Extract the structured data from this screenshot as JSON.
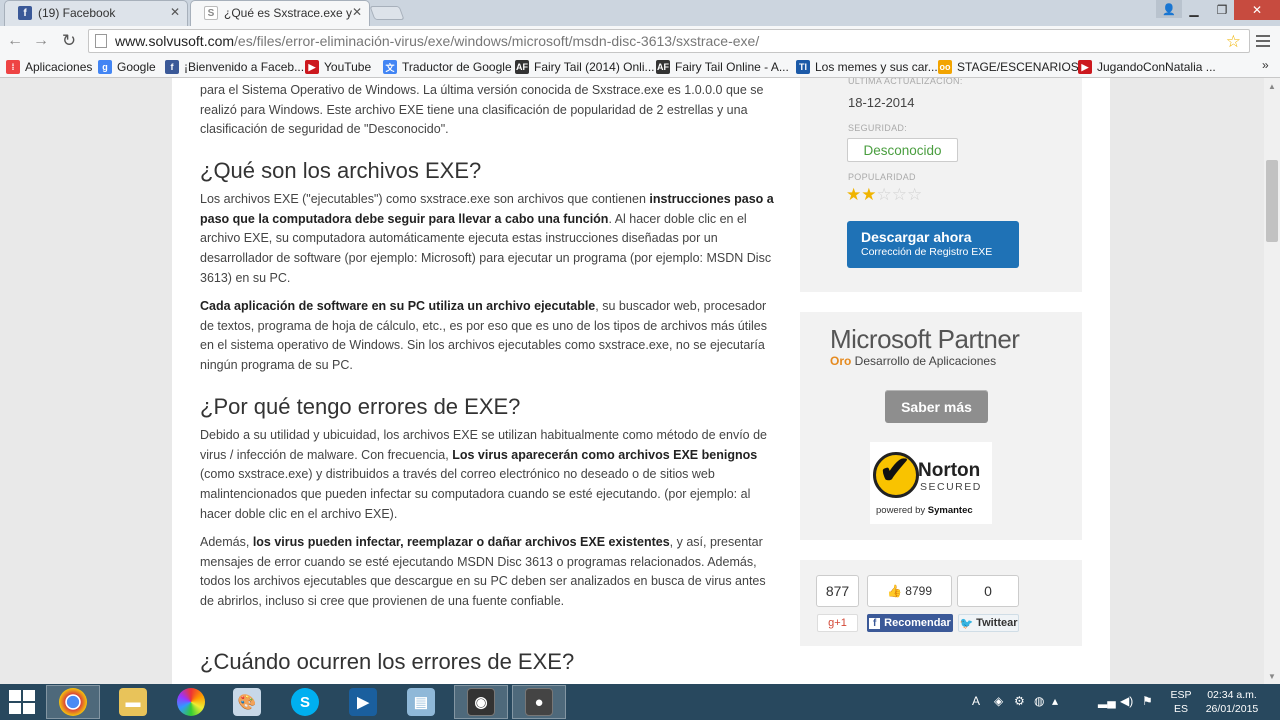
{
  "tabs": [
    {
      "title": "(19) Facebook",
      "favicon": "facebook-icon"
    },
    {
      "title": "¿Qué es Sxstrace.exe y cón",
      "favicon": "solvusoft-icon"
    }
  ],
  "address_bar": {
    "host": "www.solvusoft.com",
    "path": "/es/files/error-eliminación-virus/exe/windows/microsoft/msdn-disc-3613/sxstrace-exe/"
  },
  "bookmarks": [
    {
      "label": "Aplicaciones",
      "icon": "apps-grid-icon",
      "color": "#e44"
    },
    {
      "label": "Google",
      "icon": "google-icon",
      "color": "#4285f4"
    },
    {
      "label": "¡Bienvenido a Faceb...",
      "icon": "facebook-icon",
      "color": "#3b5998"
    },
    {
      "label": "YouTube",
      "icon": "youtube-icon",
      "color": "#cc181e"
    },
    {
      "label": "Traductor de Google",
      "icon": "translate-icon",
      "color": "#4285f4"
    },
    {
      "label": "Fairy Tail (2014) Onli...",
      "icon": "af-icon",
      "color": "#333"
    },
    {
      "label": "Fairy Tail Online - A...",
      "icon": "af-icon",
      "color": "#333"
    },
    {
      "label": "Los memes y sus car...",
      "icon": "ti-icon",
      "color": "#1c5aa8"
    },
    {
      "label": "STAGE/ESCENARIOS...",
      "icon": "stage-icon",
      "color": "#f2a400"
    },
    {
      "label": "JugandoConNatalia ...",
      "icon": "youtube-icon",
      "color": "#cc181e"
    }
  ],
  "article": {
    "intro": "para el Sistema Operativo de Windows. La última versión conocida de Sxstrace.exe es 1.0.0.0 que se realizó para Windows. Este archivo EXE tiene una clasificación de popularidad de 2 estrellas y una clasificación de seguridad de \"Desconocido\".",
    "h1": "¿Qué son los archivos EXE?",
    "p1a": "Los archivos EXE (\"ejecutables\") como sxstrace.exe son archivos que contienen ",
    "p1b": "instrucciones paso a paso que la computadora debe seguir para llevar a cabo una función",
    "p1c": ". Al hacer doble clic en el archivo EXE, su computadora automáticamente ejecuta estas instrucciones diseñadas por un desarrollador de software (por ejemplo: Microsoft) para ejecutar un programa (por ejemplo: MSDN Disc 3613) en su PC.",
    "p2a": "Cada aplicación de software en su PC utiliza un archivo ejecutable",
    "p2b": ", su buscador web, procesador de textos, programa de hoja de cálculo, etc., es por eso que es uno de los tipos de archivos más útiles en el sistema operativo de Windows. Sin los archivos ejecutables como sxstrace.exe, no se ejecutaría ningún programa de su PC.",
    "h2": "¿Por qué tengo errores de EXE?",
    "p3a": "Debido a su utilidad y ubicuidad, los archivos EXE se utilizan habitualmente como método de envío de virus / infección de malware. Con frecuencia, ",
    "p3b": "Los virus aparecerán como archivos EXE benignos",
    "p3c": " (como sxstrace.exe) y distribuidos a través del correo electrónico no deseado o de sitios web malintencionados que pueden infectar su computadora cuando se esté ejecutando. (por ejemplo: al hacer doble clic en el archivo EXE).",
    "p4a": "Además, ",
    "p4b": "los virus pueden infectar, reemplazar o dañar archivos EXE existentes",
    "p4c": ", y así, presentar mensajes de error cuando se esté ejecutando MSDN Disc 3613 o programas relacionados. Además, todos los archivos ejecutables que descargue en su PC deben ser analizados en busca de virus antes de abrirlos, incluso si cree que provienen de una fuente confiable.",
    "h3": "¿Cuándo ocurren los errores de EXE?"
  },
  "sidebar": {
    "last_update_label": "ÚLTIMA ACTUALIZACIÓN:",
    "last_update_value": "18-12-2014",
    "security_label": "SEGURIDAD:",
    "security_value": "Desconocido",
    "popularity_label": "POPULARIDAD",
    "popularity_stars": 2,
    "popularity_max": 5,
    "download_title": "Descargar ahora",
    "download_sub": "Corrección de Registro EXE",
    "ms_title": "Microsoft Partner",
    "ms_gold": "Oro",
    "ms_sub": " Desarrollo de Aplicaciones",
    "saber_mas": "Saber más",
    "norton_name": "Norton",
    "norton_secured": "SECURED",
    "norton_powered": "powered by",
    "norton_symantec": "Symantec"
  },
  "social": {
    "gplus_count": "877",
    "fb_count": "8799",
    "tw_count": "0",
    "gplus_label": "+1",
    "fb_label": "Recomendar",
    "tw_label": "Twittear"
  },
  "taskbar": {
    "lang_top": "ESP",
    "lang_bottom": "ES",
    "time": "02:34 a.m.",
    "date": "26/01/2015"
  }
}
